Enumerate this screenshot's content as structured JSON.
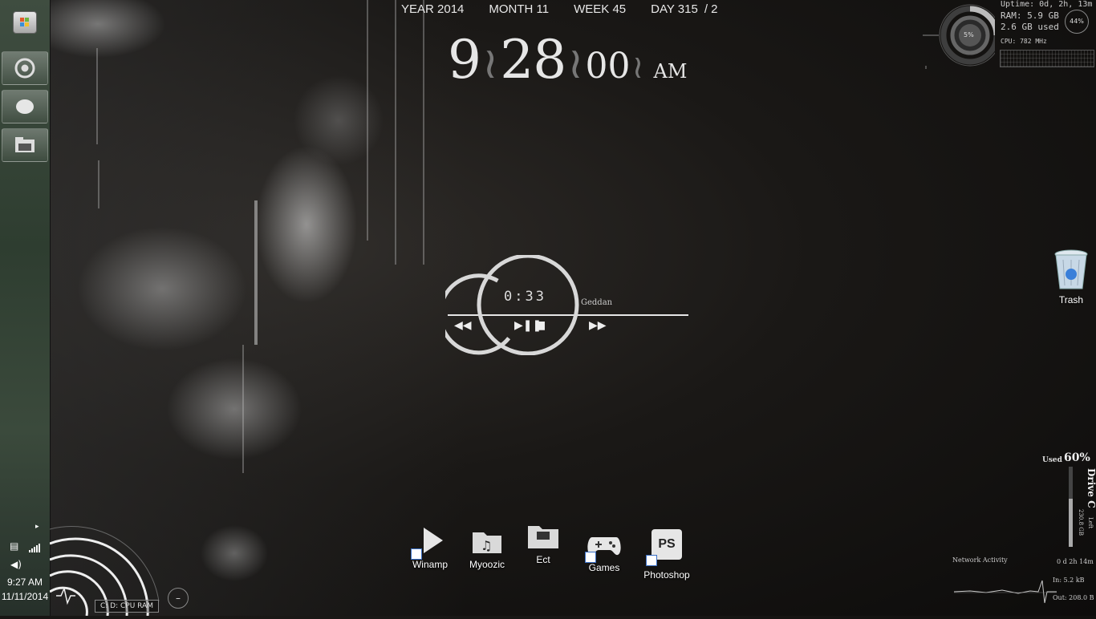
{
  "taskbar": {
    "start_label": "Start",
    "pinned": [
      {
        "name": "chrome-icon",
        "label": "Chrome"
      },
      {
        "name": "chat-bubble-icon",
        "label": "Messenger"
      },
      {
        "name": "explorer-icon",
        "label": "Explorer"
      }
    ],
    "tray_time": "9:27 AM",
    "tray_date": "11/11/2014"
  },
  "date_bar": {
    "year": "YEAR 2014",
    "month": "MONTH 11",
    "week": "WEEK 45",
    "day": "DAY 315",
    "day_suffix": "/ 2"
  },
  "clock": {
    "hour": "9",
    "minute": "28",
    "second": "00",
    "ampm": "AM"
  },
  "system_monitor": {
    "uptime": "Uptime:  0d, 2h, 13m",
    "ram": "RAM: 5.9 GB",
    "ram_used": "2.6 GB used",
    "ram_percent": "44%",
    "cpu_percent": "5%",
    "cpu": "CPU: 782 MHz"
  },
  "player": {
    "time": "0:33",
    "track": "Geddan",
    "progress": 0.33
  },
  "desktop_icons": [
    {
      "name": "winamp-icon",
      "label": "Winamp"
    },
    {
      "name": "myoozic-icon",
      "label": "Myoozic"
    },
    {
      "name": "ect-icon",
      "label": "Ect"
    },
    {
      "name": "games-icon",
      "label": "Games"
    },
    {
      "name": "photoshop-icon",
      "label": "Photoshop",
      "glyph": "PS"
    }
  ],
  "trash": {
    "label": "Trash"
  },
  "drive": {
    "used_label": "Used",
    "used_percent": "60%",
    "drive_label": "Drive C",
    "free": "230.8 GB",
    "left_label": "Left"
  },
  "network": {
    "title": "Network Activity",
    "uptime": "0 d 2h 14m",
    "in": "In: 5.2 kB",
    "out": "Out: 208.0 B"
  },
  "corner_widget": {
    "labels": "C:   D:  CPU  RAM",
    "toggle_glyph": "–"
  },
  "colors": {
    "accent": "#e6e6e6",
    "taskbar": "#3a483b"
  }
}
